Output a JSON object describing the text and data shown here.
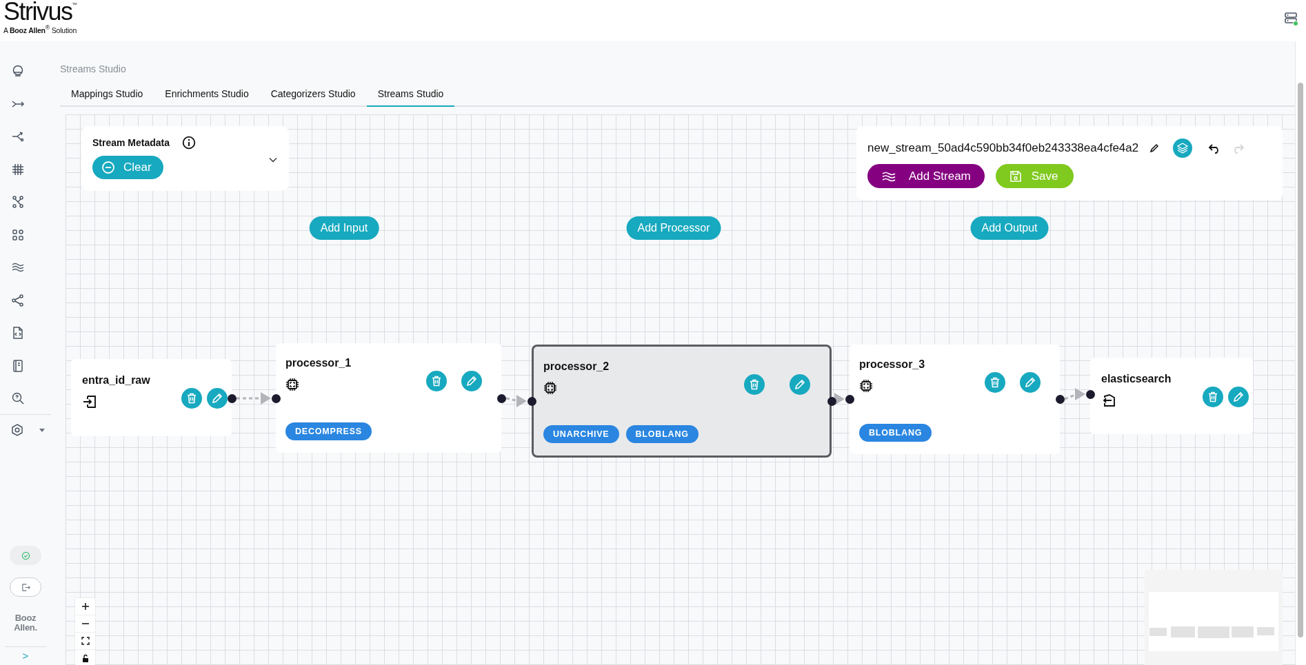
{
  "header": {
    "logo": "Strivus",
    "logo_mark": "™",
    "tagline": "A **Booz Allen**$^{®}$ Solution"
  },
  "sidebar": {
    "brand": [
      "Booz",
      "Allen."
    ],
    "expand_toggle": ">"
  },
  "breadcrumb": "Streams Studio",
  "tabs": [
    {
      "label": "Mappings Studio",
      "selected": false
    },
    {
      "label": "Enrichments Studio",
      "selected": false
    },
    {
      "label": "Categorizers Studio",
      "selected": false
    },
    {
      "label": "Streams Studio",
      "selected": true
    }
  ],
  "metadata_panel": {
    "title": "Stream Metadata",
    "clear_button": "Clear"
  },
  "stream_panel": {
    "name": "new_stream_50ad4c590bb34f0eb243338ea4cfe4a2",
    "undo": {
      "disabled": false
    },
    "redo": {
      "disabled": true
    },
    "add_stream_button": "Add Stream",
    "save_button": "Save"
  },
  "add_buttons": [
    "Add Input",
    "Add Processor",
    "Add Output"
  ],
  "nodes": [
    {
      "kind": "input",
      "label": "entra_id_raw",
      "selected": false
    },
    {
      "kind": "processor",
      "label": "processor_1",
      "selected": false,
      "tags": [
        "DECOMPRESS"
      ]
    },
    {
      "kind": "processor",
      "label": "processor_2",
      "selected": true,
      "tags": [
        "UNARCHIVE",
        "BLOBLANG"
      ]
    },
    {
      "kind": "processor",
      "label": "processor_3",
      "selected": false,
      "tags": [
        "BLOBLANG"
      ]
    },
    {
      "kind": "output",
      "label": "elasticsearch",
      "selected": false
    }
  ]
}
